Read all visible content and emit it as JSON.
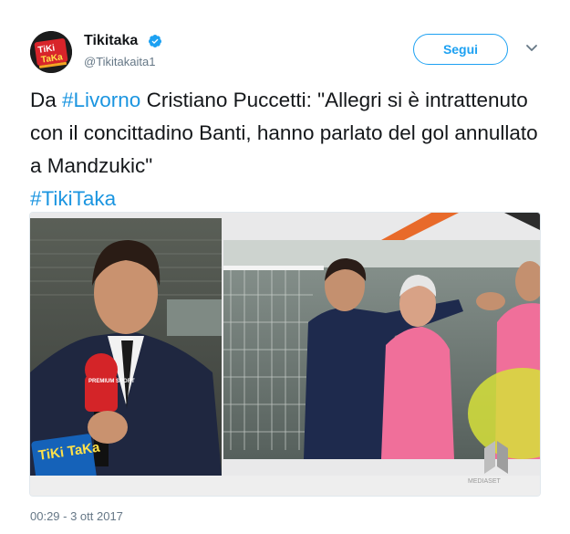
{
  "header": {
    "account_name": "Tikitaka",
    "handle": "@Tikitakaita1",
    "follow_label": "Segui",
    "avatar_logo_text": "TiKi TaKa"
  },
  "tweet": {
    "line1_prefix": "Da ",
    "hashtag1": "#Livorno",
    "line1_rest": " Cristiano Puccetti: \"Allegri si è intrattenuto con il concittadino Banti, hanno parlato del gol annullato a Mandzukic\"",
    "hashtag2": "#TikiTaka"
  },
  "media": {
    "left_mic_label": "PREMIUM SPORT",
    "overlay_logo": "TiKi TaKa",
    "channel_bug": "MEDIASET"
  },
  "footer": {
    "timestamp": "00:29 - 3 ott 2017"
  },
  "colors": {
    "link": "#1b95e0",
    "follow": "#1da1f2",
    "secondary_text": "#657786"
  }
}
